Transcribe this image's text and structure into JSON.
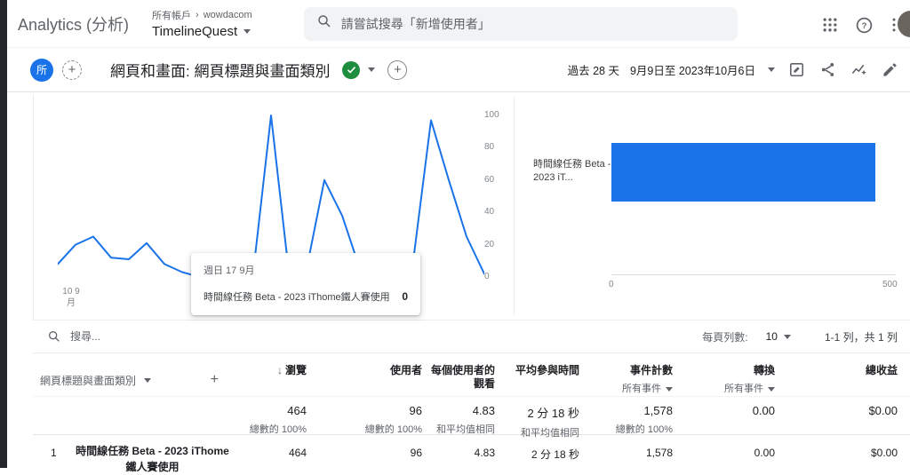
{
  "colors": {
    "primary_blue": "#1a73e8",
    "check_green": "#1e8e3e"
  },
  "header": {
    "logo": "Analytics (分析)",
    "breadcrumb_root": "所有帳戶",
    "breadcrumb_separator": "›",
    "breadcrumb_current": "wowdacom",
    "property_name": "TimelineQuest",
    "search_placeholder": "請嘗試搜尋「新增使用者」"
  },
  "toolbar": {
    "scope_chip": "所",
    "plus_symbol": "+",
    "report_title": "網頁和畫面: 網頁標題與畫面類別",
    "date_range_label": "過去 28 天",
    "date_range_value": "9月9日至 2023年10月6日"
  },
  "chart_data": [
    {
      "type": "line",
      "series": [
        {
          "name": "時間線任務 Beta - 2023 iThome鐵人賽使用",
          "values": [
            8,
            20,
            25,
            12,
            11,
            21,
            8,
            3,
            0,
            1,
            2,
            3,
            100,
            3,
            5,
            60,
            38,
            5,
            0,
            0,
            10,
            97,
            60,
            25,
            2
          ]
        }
      ],
      "x_ticks": [
        "10 9月",
        "17"
      ],
      "y_ticks": [
        100,
        80,
        60,
        40,
        20,
        0
      ],
      "ylim": [
        0,
        100
      ],
      "color": "#1a73e8",
      "grid": false,
      "legend": "none"
    },
    {
      "type": "bar",
      "orientation": "horizontal",
      "categories": [
        "時間線任務 Beta - 2023 iT..."
      ],
      "values": [
        464
      ],
      "xlim": [
        0,
        500
      ],
      "x_ticks": [
        "0",
        "500"
      ],
      "color": "#1a73e8"
    }
  ],
  "tooltip": {
    "title": "週日 17 9月",
    "series_name": "時間線任務 Beta - 2023 iThome鐵人賽使用",
    "value": "0"
  },
  "table_controls": {
    "search_placeholder": "搜尋...",
    "rows_per_page_label": "每頁列數:",
    "rows_per_page_value": "10",
    "pagination_text": "1-1 列，共 1 列"
  },
  "table": {
    "dimension_header": "網頁標題與畫面類別",
    "dimension_add_symbol": "+",
    "sort_arrow": "↓",
    "columns": [
      {
        "label": "瀏覽"
      },
      {
        "label": "使用者"
      },
      {
        "label": "每個使用者的觀看"
      },
      {
        "label": "平均參與時間"
      },
      {
        "label": "事件計數",
        "sub": "所有事件"
      },
      {
        "label": "轉換",
        "sub": "所有事件"
      },
      {
        "label": "總收益"
      }
    ],
    "totals": {
      "values": [
        "464",
        "96",
        "4.83",
        "2 分 18 秒",
        "1,578",
        "0.00",
        "$0.00"
      ],
      "subtexts": [
        "總數的 100%",
        "總數的 100%",
        "和平均值相同",
        "和平均值相同",
        "總數的 100%",
        "",
        ""
      ]
    },
    "rows": [
      {
        "index": "1",
        "name": "時間線任務 Beta - 2023 iThome鐵人賽使用",
        "values": [
          "464",
          "96",
          "4.83",
          "2 分 18 秒",
          "1,578",
          "0.00",
          "$0.00"
        ]
      }
    ]
  }
}
